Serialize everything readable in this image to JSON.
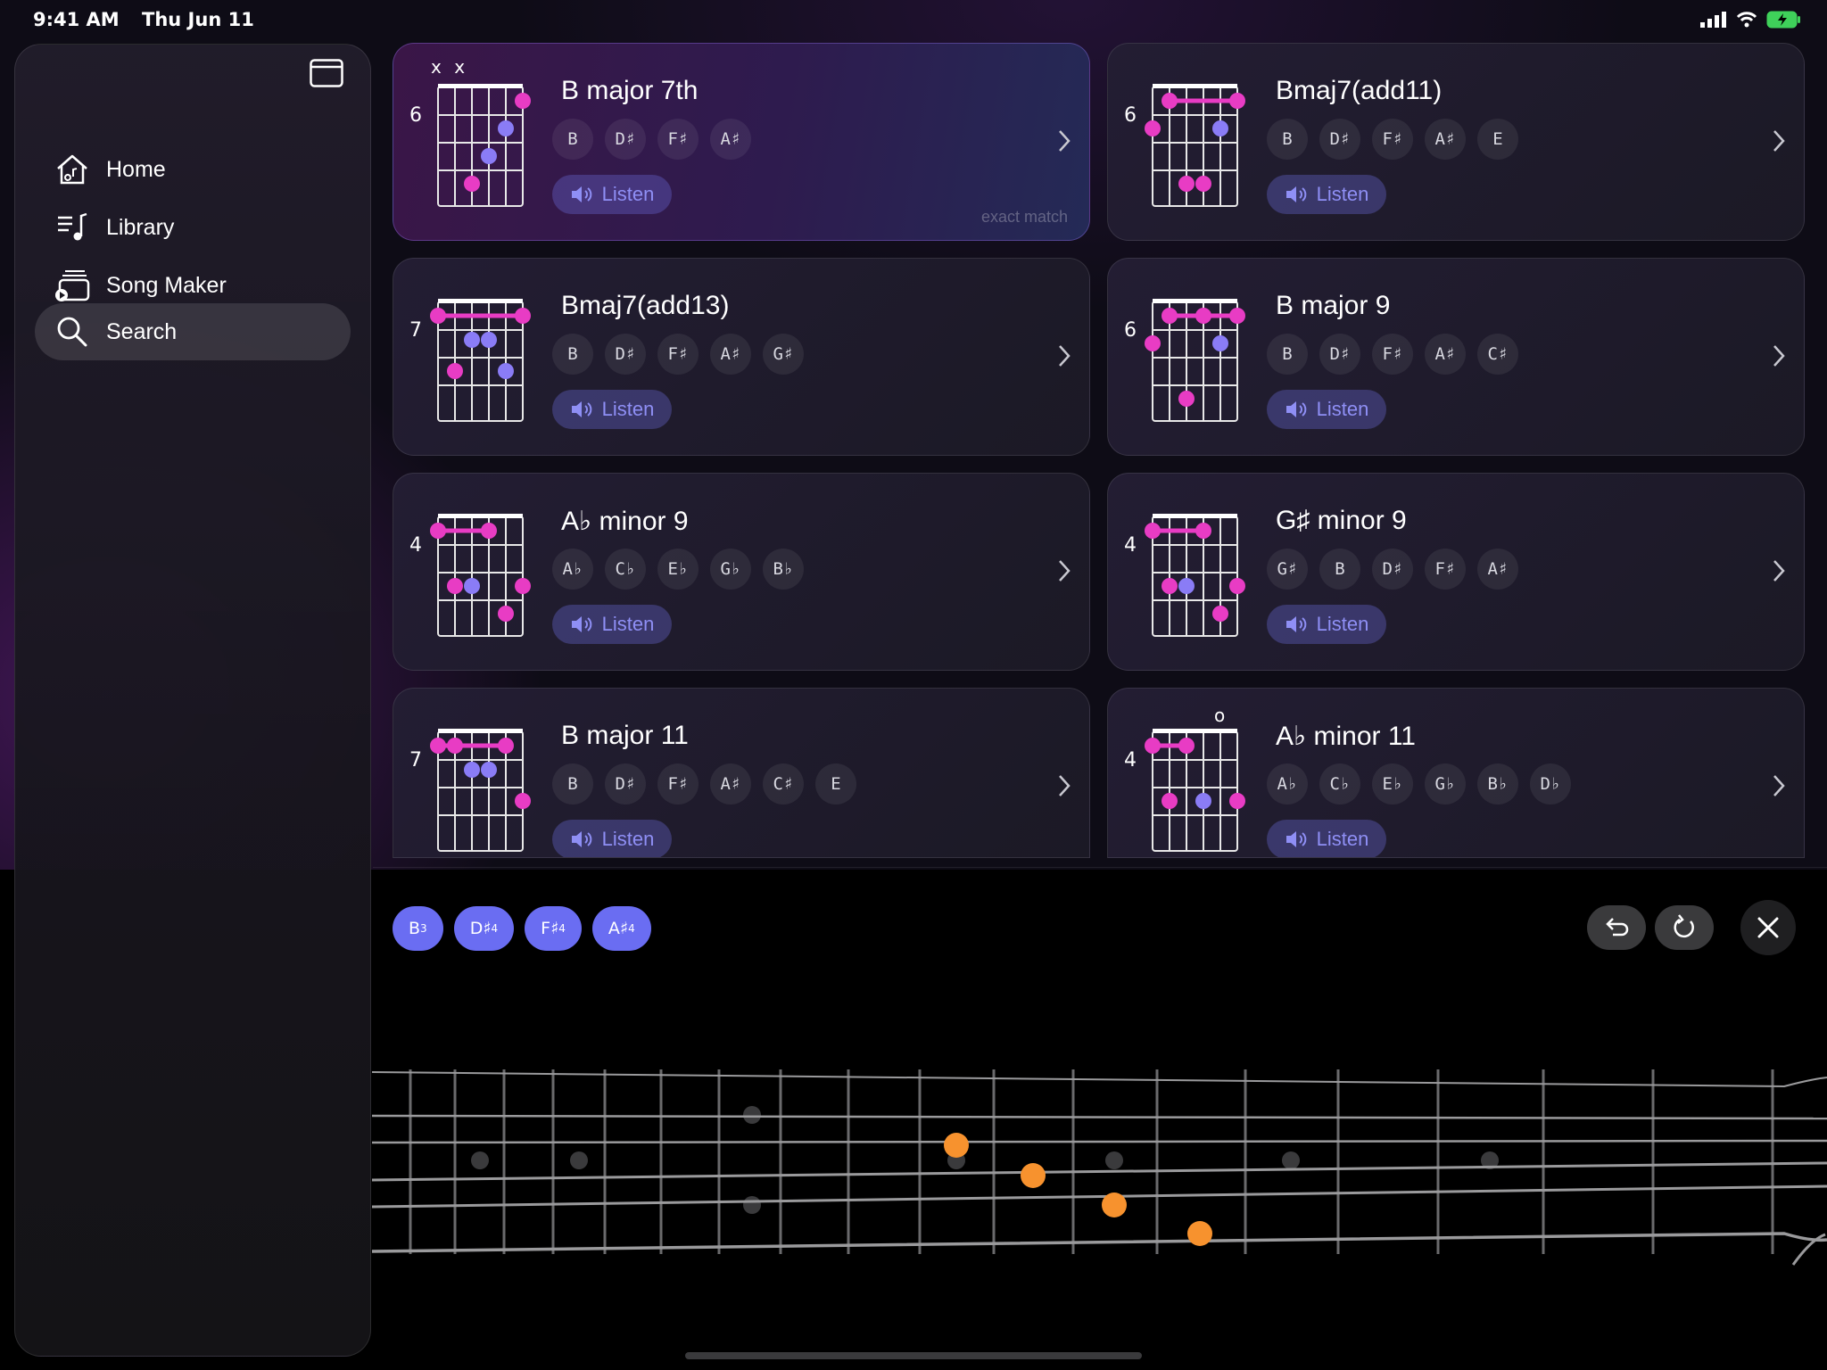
{
  "status": {
    "time": "9:41 AM",
    "date": "Thu Jun 11"
  },
  "sidebar": {
    "items": [
      {
        "label": "Home",
        "icon": "home-icon"
      },
      {
        "label": "Library",
        "icon": "library-icon"
      },
      {
        "label": "Song Maker",
        "icon": "song-maker-icon"
      },
      {
        "label": "Search",
        "icon": "search-icon",
        "active": true
      }
    ]
  },
  "cards": [
    {
      "name": "B major 7th",
      "fret": "6",
      "notes": [
        "B",
        "D♯",
        "F♯",
        "A♯"
      ],
      "listen": "Listen",
      "badge": "exact match",
      "mute": "x x"
    },
    {
      "name": "Bmaj7(add11)",
      "fret": "6",
      "notes": [
        "B",
        "D♯",
        "F♯",
        "A♯",
        "E"
      ],
      "listen": "Listen"
    },
    {
      "name": "Bmaj7(add13)",
      "fret": "7",
      "notes": [
        "B",
        "D♯",
        "F♯",
        "A♯",
        "G♯"
      ],
      "listen": "Listen"
    },
    {
      "name": "B major 9",
      "fret": "6",
      "notes": [
        "B",
        "D♯",
        "F♯",
        "A♯",
        "C♯"
      ],
      "listen": "Listen"
    },
    {
      "name": "A♭ minor 9",
      "fret": "4",
      "notes": [
        "A♭",
        "C♭",
        "E♭",
        "G♭",
        "B♭"
      ],
      "listen": "Listen"
    },
    {
      "name": "G♯ minor 9",
      "fret": "4",
      "notes": [
        "G♯",
        "B",
        "D♯",
        "F♯",
        "A♯"
      ],
      "listen": "Listen"
    },
    {
      "name": "B major 11",
      "fret": "7",
      "notes": [
        "B",
        "D♯",
        "F♯",
        "A♯",
        "C♯",
        "E"
      ],
      "listen": "Listen"
    },
    {
      "name": "A♭ minor 11",
      "fret": "4",
      "notes": [
        "A♭",
        "C♭",
        "E♭",
        "G♭",
        "B♭",
        "D♭"
      ],
      "listen": "Listen",
      "open": "o"
    }
  ],
  "selected_notes": [
    {
      "note": "B",
      "octave": "3"
    },
    {
      "note": "D♯",
      "octave": "4"
    },
    {
      "note": "F♯",
      "octave": "4"
    },
    {
      "note": "A♯",
      "octave": "4"
    }
  ],
  "colors": {
    "accent": "#6a6df2",
    "dot_pink": "#e83cc4",
    "dot_violet": "#8a7cf6",
    "fret_marker": "#f7922e"
  }
}
